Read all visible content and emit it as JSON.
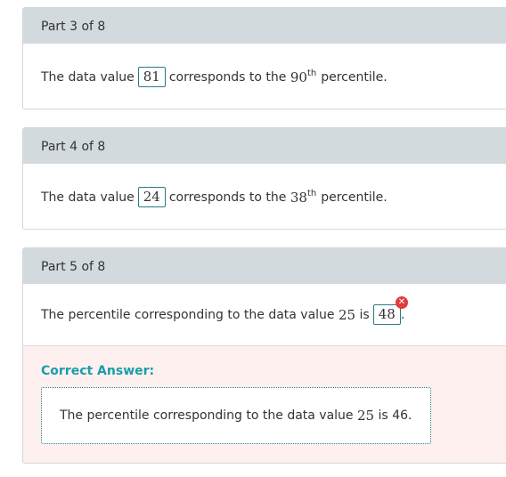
{
  "parts": [
    {
      "header": "Part 3 of 8",
      "prefix": "The data value",
      "value": "81",
      "middle": "corresponds to the",
      "percentile": "90",
      "ordinal": "th",
      "suffix": "percentile."
    },
    {
      "header": "Part 4 of 8",
      "prefix": "The data value",
      "value": "24",
      "middle": "corresponds to the",
      "percentile": "38",
      "ordinal": "th",
      "suffix": "percentile."
    },
    {
      "header": "Part 5 of 8",
      "prefix": "The percentile corresponding to the data value",
      "data_value": "25",
      "is_text": "is",
      "answer": "48",
      "end": ".",
      "incorrect_icon": "x-icon",
      "correct_answer": {
        "label": "Correct Answer:",
        "prefix": "The percentile corresponding to the data value",
        "data_value": "25",
        "is_text": "is",
        "value": "46."
      }
    }
  ],
  "colors": {
    "header_bg": "#d3dadd",
    "accent": "#1a9dab",
    "error": "#e23b3b",
    "correct_panel_bg": "#fdf0ef"
  }
}
